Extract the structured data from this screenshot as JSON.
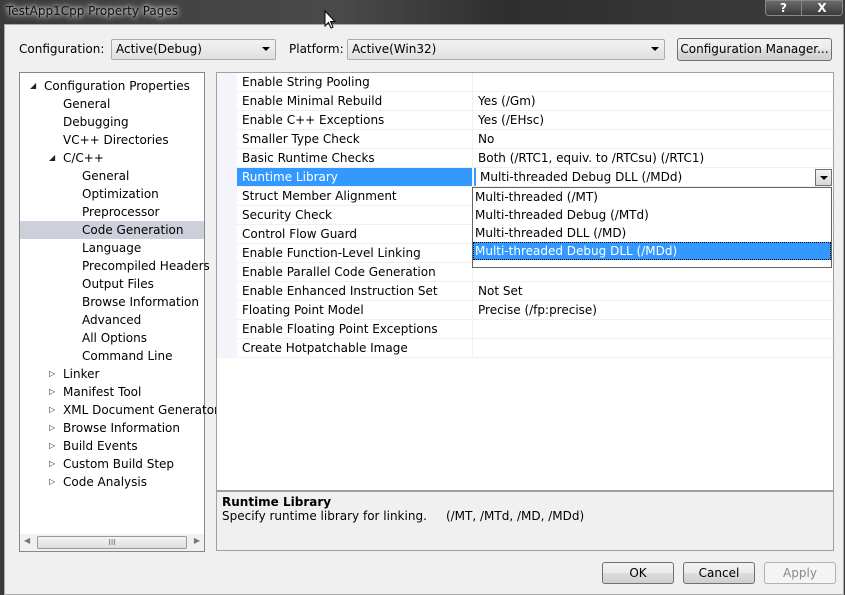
{
  "window": {
    "title": "TestApp1Cpp Property Pages",
    "help_label": "?",
    "close_label": "X"
  },
  "toolbar": {
    "configuration_label": "Configuration:",
    "configuration_value": "Active(Debug)",
    "platform_label": "Platform:",
    "platform_value": "Active(Win32)",
    "config_manager_label": "Configuration Manager..."
  },
  "tree": {
    "items": [
      {
        "label": "Configuration Properties",
        "level": 0,
        "expander": "expanded"
      },
      {
        "label": "General",
        "level": 1,
        "expander": "none"
      },
      {
        "label": "Debugging",
        "level": 1,
        "expander": "none"
      },
      {
        "label": "VC++ Directories",
        "level": 1,
        "expander": "none"
      },
      {
        "label": "C/C++",
        "level": 1,
        "expander": "expanded"
      },
      {
        "label": "General",
        "level": 2,
        "expander": "none"
      },
      {
        "label": "Optimization",
        "level": 2,
        "expander": "none"
      },
      {
        "label": "Preprocessor",
        "level": 2,
        "expander": "none"
      },
      {
        "label": "Code Generation",
        "level": 2,
        "expander": "none",
        "selected": true
      },
      {
        "label": "Language",
        "level": 2,
        "expander": "none"
      },
      {
        "label": "Precompiled Headers",
        "level": 2,
        "expander": "none"
      },
      {
        "label": "Output Files",
        "level": 2,
        "expander": "none"
      },
      {
        "label": "Browse Information",
        "level": 2,
        "expander": "none"
      },
      {
        "label": "Advanced",
        "level": 2,
        "expander": "none"
      },
      {
        "label": "All Options",
        "level": 2,
        "expander": "none"
      },
      {
        "label": "Command Line",
        "level": 2,
        "expander": "none"
      },
      {
        "label": "Linker",
        "level": 1,
        "expander": "collapsed"
      },
      {
        "label": "Manifest Tool",
        "level": 1,
        "expander": "collapsed"
      },
      {
        "label": "XML Document Generator",
        "level": 1,
        "expander": "collapsed"
      },
      {
        "label": "Browse Information",
        "level": 1,
        "expander": "collapsed"
      },
      {
        "label": "Build Events",
        "level": 1,
        "expander": "collapsed"
      },
      {
        "label": "Custom Build Step",
        "level": 1,
        "expander": "collapsed"
      },
      {
        "label": "Code Analysis",
        "level": 1,
        "expander": "collapsed"
      }
    ],
    "scroll_thumb_grip": "III"
  },
  "grid": {
    "rows": [
      {
        "name": "Enable String Pooling",
        "value": ""
      },
      {
        "name": "Enable Minimal Rebuild",
        "value": "Yes (/Gm)"
      },
      {
        "name": "Enable C++ Exceptions",
        "value": "Yes (/EHsc)"
      },
      {
        "name": "Smaller Type Check",
        "value": "No"
      },
      {
        "name": "Basic Runtime Checks",
        "value": "Both (/RTC1, equiv. to /RTCsu) (/RTC1)"
      },
      {
        "name": "Runtime Library",
        "value": "Multi-threaded Debug DLL (/MDd)",
        "selected": true
      },
      {
        "name": "Struct Member Alignment",
        "value": ""
      },
      {
        "name": "Security Check",
        "value": ""
      },
      {
        "name": "Control Flow Guard",
        "value": ""
      },
      {
        "name": "Enable Function-Level Linking",
        "value": ""
      },
      {
        "name": "Enable Parallel Code Generation",
        "value": ""
      },
      {
        "name": "Enable Enhanced Instruction Set",
        "value": "Not Set"
      },
      {
        "name": "Floating Point Model",
        "value": "Precise (/fp:precise)"
      },
      {
        "name": "Enable Floating Point Exceptions",
        "value": ""
      },
      {
        "name": "Create Hotpatchable Image",
        "value": ""
      }
    ]
  },
  "dropdown": {
    "options": [
      {
        "label": "Multi-threaded (/MT)"
      },
      {
        "label": "Multi-threaded Debug (/MTd)"
      },
      {
        "label": "Multi-threaded DLL (/MD)"
      },
      {
        "label": "Multi-threaded Debug DLL (/MDd)",
        "selected": true
      }
    ]
  },
  "description": {
    "title": "Runtime Library",
    "text": "Specify runtime library for linking.     (/MT, /MTd, /MD, /MDd)"
  },
  "buttons": {
    "ok": "OK",
    "cancel": "Cancel",
    "apply": "Apply"
  },
  "colors": {
    "selection": "#3399ff",
    "tree_selection": "#cdd0da"
  }
}
